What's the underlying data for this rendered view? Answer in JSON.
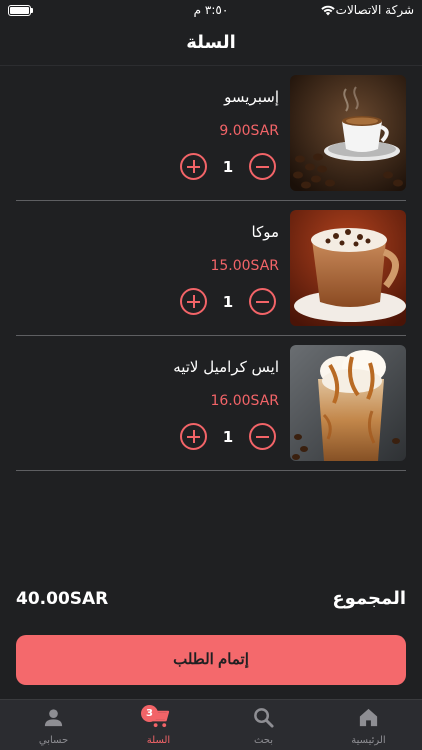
{
  "status_bar": {
    "carrier": "شركة الاتصالات",
    "time": "٣:٥٠ م",
    "battery_level": 1.0
  },
  "header": {
    "title": "السلة"
  },
  "cart": {
    "items": [
      {
        "name": "إسبريسو",
        "price": "9.00SAR",
        "quantity": "1",
        "image": "espresso-cup-photo"
      },
      {
        "name": "موكا",
        "price": "15.00SAR",
        "quantity": "1",
        "image": "mocha-mug-photo"
      },
      {
        "name": "ايس كراميل لاتيه",
        "price": "16.00SAR",
        "quantity": "1",
        "image": "iced-caramel-latte-photo"
      }
    ],
    "total_label": "المجموع",
    "total_value": "40.00SAR",
    "checkout_label": "إتمام الطلب"
  },
  "tab_bar": {
    "items": [
      {
        "label": "الرئيسية",
        "icon": "home-icon"
      },
      {
        "label": "بحث",
        "icon": "search-icon"
      },
      {
        "label": "السلة",
        "icon": "cart-icon",
        "badge": "3",
        "active": true
      },
      {
        "label": "حسابي",
        "icon": "person-icon"
      }
    ]
  },
  "colors": {
    "background": "#1f2022",
    "accent": "#f26468",
    "button": "#f4696c",
    "tab_bar": "#2b2c30",
    "inactive": "#8e8e93"
  }
}
